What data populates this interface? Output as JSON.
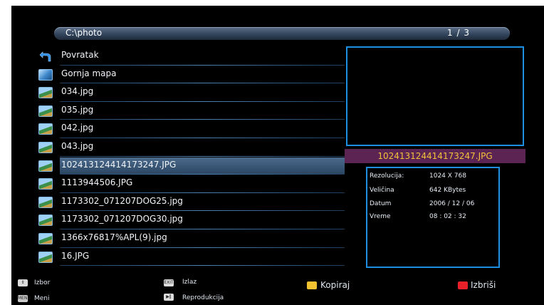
{
  "path_bar": {
    "path": "C:\\photo",
    "page": "1 / 3"
  },
  "files": [
    {
      "name": "Povratak",
      "icon": "back-arrow-icon"
    },
    {
      "name": "Gornja mapa",
      "icon": "folder-icon"
    },
    {
      "name": "034.jpg",
      "icon": "image-icon"
    },
    {
      "name": "035.jpg",
      "icon": "image-icon"
    },
    {
      "name": "042.jpg",
      "icon": "image-icon"
    },
    {
      "name": "043.jpg",
      "icon": "image-icon"
    },
    {
      "name": "102413124414173247.JPG",
      "icon": "image-icon",
      "selected": true
    },
    {
      "name": "1113944506.JPG",
      "icon": "image-icon"
    },
    {
      "name": "1173302_071207DOG25.jpg",
      "icon": "image-icon"
    },
    {
      "name": "1173302_071207DOG30.jpg",
      "icon": "image-icon"
    },
    {
      "name": "1366x76817%APL(9).jpg",
      "icon": "image-icon"
    },
    {
      "name": "16.JPG",
      "icon": "image-icon"
    }
  ],
  "preview": {
    "filename": "102413124414173247.JPG",
    "info": [
      {
        "label": "Rezolucija:",
        "value": "1024  X  768"
      },
      {
        "label": "Veličina",
        "value": "642  KBytes"
      },
      {
        "label": "Datum",
        "value": "2006 / 12 / 06"
      },
      {
        "label": "Vreme",
        "value": "08 : 02 : 32"
      }
    ]
  },
  "footer": {
    "izbor": "Izbor",
    "meni": "Meni",
    "izlaz": "Izlaz",
    "reprodukcija": "Reprodukcija",
    "kopiraj": "Kopiraj",
    "izbrisi": "Izbriši",
    "menu_key": "MENU",
    "exit_key": "EXIT"
  },
  "colors": {
    "accent_border": "#1d8fe0",
    "filename_bg": "#5b2453",
    "filename_text": "#f3c23a",
    "yellow_key": "#f2c230",
    "red_key": "#e8202a"
  }
}
